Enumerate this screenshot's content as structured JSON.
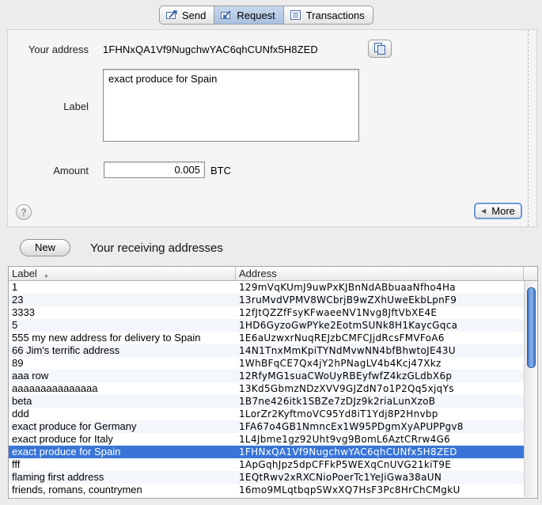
{
  "tabs": [
    {
      "label": "Send",
      "icon": "send-icon"
    },
    {
      "label": "Request",
      "icon": "request-icon"
    },
    {
      "label": "Transactions",
      "icon": "transactions-icon"
    }
  ],
  "form": {
    "address_label": "Your address",
    "address_value": "1FHNxQA1Vf9NugchwYAC6qhCUNfx5H8ZED",
    "label_label": "Label",
    "label_value": "exact produce for Spain",
    "amount_label": "Amount",
    "amount_value": "0.005",
    "unit": "BTC",
    "help_glyph": "?",
    "more_label": "More"
  },
  "addresses": {
    "new_label": "New",
    "title": "Your receiving addresses",
    "columns": [
      "Label",
      "Address"
    ],
    "rows": [
      [
        "1",
        "129mVqKUmJ9uwPxKJBnNdABbuaaNfho4Ha"
      ],
      [
        "23",
        "13ruMvdVPMV8WCbrjB9wZXhUweEkbLpnF9"
      ],
      [
        "3333",
        "12fJtQZZfFsyKFwaeeNV1Nvg8JftVbXE4E"
      ],
      [
        "5",
        "1HD6GyzoGwPYke2EotmSUNk8H1KaycGqca"
      ],
      [
        "555 my new address for delivery to Spain",
        "1E6aUzwxrNuqREJzbCMFCJjdRcsFMVFoA6"
      ],
      [
        "66 Jim's terrific address",
        "14N1TnxMmKpiTYNdMvwNN4bfBhwtoJE43U"
      ],
      [
        "89",
        "1WhBFqCE7Qx4jY2hPNagLV4b4Kcj47Xkz"
      ],
      [
        "aaa row",
        "12RfyMG1suaCWoUyRBEyfwfZ4kzGLdbX6p"
      ],
      [
        "aaaaaaaaaaaaaaa",
        "13Kd5GbmzNDzXVV9GJZdN7o1P2Qq5xjqYs"
      ],
      [
        "beta",
        "1B7ne426itk1SBZe7zDJz9k2riaLunXzoB"
      ],
      [
        "ddd",
        "1LorZr2KyftmoVC95Yd8iT1Ydj8P2Hnvbp"
      ],
      [
        "exact produce for Germany",
        "1FA67o4GB1NmncEx1W95PDgmXyAPUPPgv8"
      ],
      [
        "exact produce for Italy",
        "1L4Jbme1gz92Uht9vg9BomL6AztCRrw4G6"
      ],
      [
        "exact produce for Spain",
        "1FHNxQA1Vf9NugchwYAC6qhCUNfx5H8ZED"
      ],
      [
        "fff",
        "1ApGqhJpz5dpCFFkP5WEXqCnUVG21kiT9E"
      ],
      [
        "flaming first address",
        "1EQtRwv2xRXCNioPoerTc1YeJiGwa38aUN"
      ],
      [
        "friends, romans, countrymen",
        "16mo9MLqtbqpSWxXQ7HsF3Pc8HrChCMgkU"
      ]
    ],
    "selected_index": 13
  }
}
